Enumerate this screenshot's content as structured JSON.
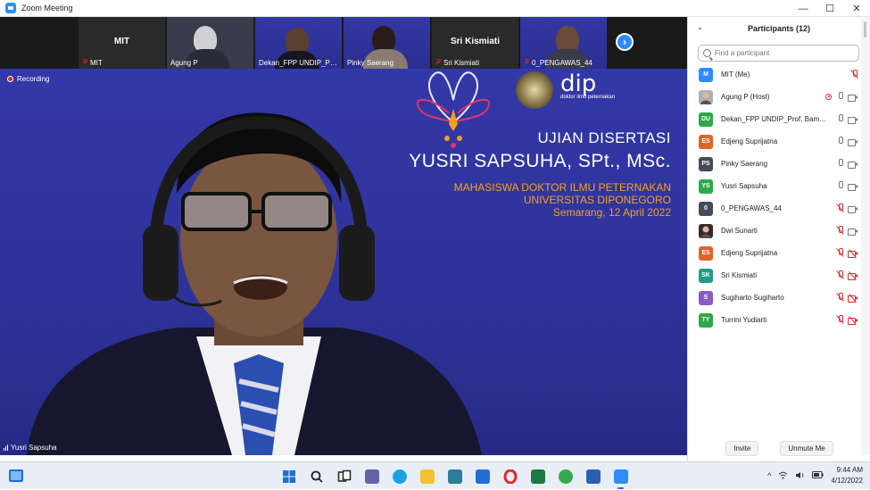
{
  "window": {
    "title": "Zoom Meeting",
    "buttons": [
      "—",
      "☐",
      "✕"
    ]
  },
  "thumbnails": [
    {
      "big_name": "MIT",
      "label": "MIT",
      "muted": true,
      "kind": "name"
    },
    {
      "label": "Agung P",
      "muted": false,
      "kind": "video"
    },
    {
      "label": "Dekan_FPP UNDIP_Prof. ...",
      "muted": false,
      "kind": "video"
    },
    {
      "label": "Pinky Saerang",
      "muted": false,
      "kind": "video"
    },
    {
      "big_name": "Sri Kismiati",
      "label": "Sri Kismiati",
      "muted": true,
      "kind": "name"
    },
    {
      "label": "0_PENGAWAS_44",
      "muted": true,
      "kind": "video"
    }
  ],
  "video": {
    "recording_label": "Recording",
    "speaker_name": "Yusri Sapsuha",
    "banner": {
      "logo_text": "dip",
      "logo_sub": "doktor ilmu peternakan",
      "line1": "UJIAN DISERTASI",
      "line2": "YUSRI SAPSUHA, SPt., MSc.",
      "line3": "MAHASISWA DOKTOR ILMU PETERNAKAN",
      "line4": "UNIVERSITAS DIPONEGORO",
      "line5": "Semarang, 12 April 2022"
    }
  },
  "participants_panel": {
    "title": "Participants (12)",
    "search_placeholder": "Find a participant",
    "participants": [
      {
        "initials": "M",
        "name": "MIT (Me)",
        "color": "#2d8cff",
        "photo": false,
        "mic": "muted",
        "cam": "none",
        "rec": false
      },
      {
        "initials": "",
        "name": "Agung P (Host)",
        "color": "#b0b0b0",
        "photo": true,
        "mic": "on",
        "cam": "on",
        "rec": true
      },
      {
        "initials": "DU",
        "name": "Dekan_FPP UNDIP_Prof. Bambang...",
        "color": "#2ea84a",
        "photo": false,
        "mic": "on",
        "cam": "on",
        "rec": false
      },
      {
        "initials": "ES",
        "name": "Edjeng Suprijatna",
        "color": "#e0632a",
        "photo": false,
        "mic": "on",
        "cam": "on",
        "rec": false
      },
      {
        "initials": "PS",
        "name": "Pinky Saerang",
        "color": "#444c58",
        "photo": false,
        "mic": "on",
        "cam": "on",
        "rec": false
      },
      {
        "initials": "YS",
        "name": "Yusri Sapsuha",
        "color": "#2ea84a",
        "photo": false,
        "mic": "on",
        "cam": "on",
        "rec": false
      },
      {
        "initials": "0",
        "name": "0_PENGAWAS_44",
        "color": "#444c58",
        "photo": false,
        "mic": "muted",
        "cam": "on",
        "rec": false
      },
      {
        "initials": "",
        "name": "Dwi Sunarti",
        "color": "#3a2a2a",
        "photo": true,
        "mic": "muted",
        "cam": "on",
        "rec": false
      },
      {
        "initials": "ES",
        "name": "Edjeng Suprijatna",
        "color": "#e0632a",
        "photo": false,
        "mic": "muted",
        "cam": "off",
        "rec": false
      },
      {
        "initials": "SK",
        "name": "Sri Kismiati",
        "color": "#1c9e88",
        "photo": false,
        "mic": "muted",
        "cam": "off",
        "rec": false
      },
      {
        "initials": "S",
        "name": "Sugiharto Sugiharto",
        "color": "#8a5ac8",
        "photo": false,
        "mic": "muted",
        "cam": "off",
        "rec": false
      },
      {
        "initials": "TY",
        "name": "Turrini Yudiarti",
        "color": "#2ea84a",
        "photo": false,
        "mic": "muted",
        "cam": "off",
        "rec": false
      }
    ],
    "invite_label": "Invite",
    "unmute_label": "Unmute Me"
  },
  "taskbar": {
    "time": "9:44 AM",
    "date": "4/12/2022",
    "tray_caret": "^",
    "apps": [
      {
        "name": "start-icon",
        "color": "#1f6fd1"
      },
      {
        "name": "search-icon",
        "color": "#222222"
      },
      {
        "name": "task-view-icon",
        "color": "#222222"
      },
      {
        "name": "chat-icon",
        "color": "#6264a7"
      },
      {
        "name": "edge-icon",
        "color": "#1ba1e2"
      },
      {
        "name": "file-explorer-icon",
        "color": "#f2c233"
      },
      {
        "name": "store-icon",
        "color": "#2d7d9a"
      },
      {
        "name": "mail-icon",
        "color": "#1f6fd1"
      },
      {
        "name": "opera-icon",
        "color": "#e0282e"
      },
      {
        "name": "excel-icon",
        "color": "#1e7a44"
      },
      {
        "name": "chrome-icon",
        "color": "#34a853"
      },
      {
        "name": "word-icon",
        "color": "#2b5fb4"
      },
      {
        "name": "zoom-icon",
        "color": "#2d8cff"
      }
    ]
  }
}
